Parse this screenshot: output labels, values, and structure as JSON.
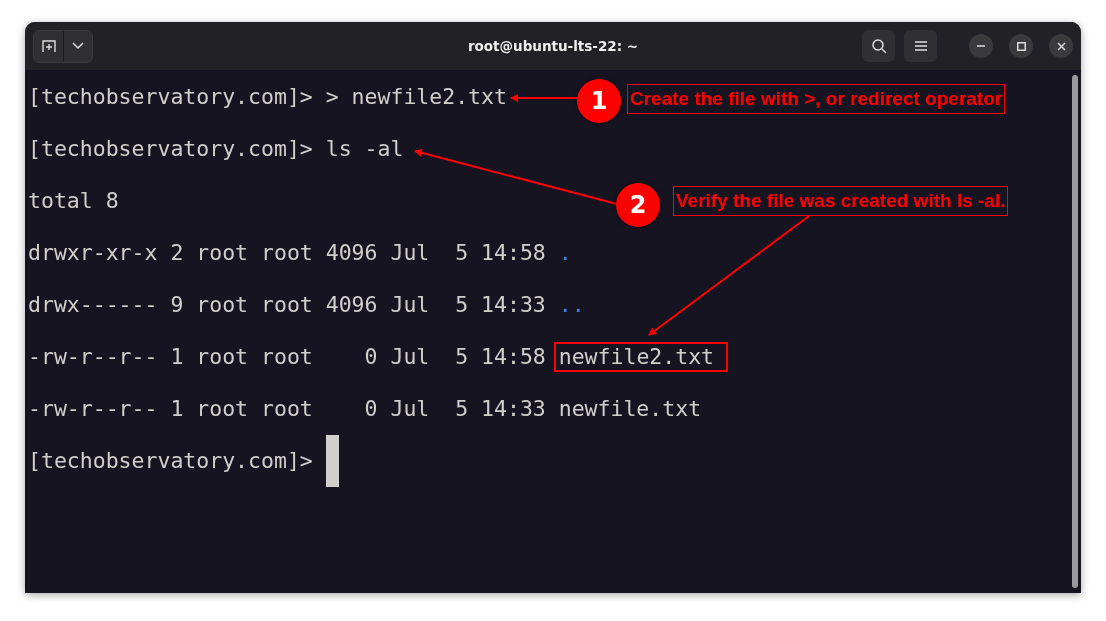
{
  "window": {
    "title": "root@ubuntu-lts-22: ~"
  },
  "terminal": {
    "lines": [
      {
        "segments": [
          {
            "text": "[techobservatory.com]> > newfile2.txt",
            "kind": "plain"
          }
        ]
      },
      {
        "segments": [
          {
            "text": "[techobservatory.com]> ls -al",
            "kind": "plain"
          }
        ]
      },
      {
        "segments": [
          {
            "text": "total 8",
            "kind": "plain"
          }
        ]
      },
      {
        "segments": [
          {
            "text": "drwxr-xr-x 2 root root 4096 Jul  5 14:58 ",
            "kind": "plain"
          },
          {
            "text": ".",
            "kind": "directory"
          }
        ]
      },
      {
        "segments": [
          {
            "text": "drwx------ 9 root root 4096 Jul  5 14:33 ",
            "kind": "plain"
          },
          {
            "text": "..",
            "kind": "directory"
          }
        ]
      },
      {
        "segments": [
          {
            "text": "-rw-r--r-- 1 root root    0 Jul  5 14:58 ",
            "kind": "plain"
          },
          {
            "text": "newfile2.txt",
            "kind": "boxed"
          }
        ]
      },
      {
        "segments": [
          {
            "text": "-rw-r--r-- 1 root root    0 Jul  5 14:33 newfile.txt",
            "kind": "plain"
          }
        ]
      },
      {
        "segments": [
          {
            "text": "[techobservatory.com]> ",
            "kind": "plain"
          }
        ]
      }
    ],
    "cursor": true
  },
  "annotations": [
    {
      "number": "1",
      "text": "Create the file with >, or redirect operator"
    },
    {
      "number": "2",
      "text": "Verify the file was created with ls -al."
    }
  ]
}
